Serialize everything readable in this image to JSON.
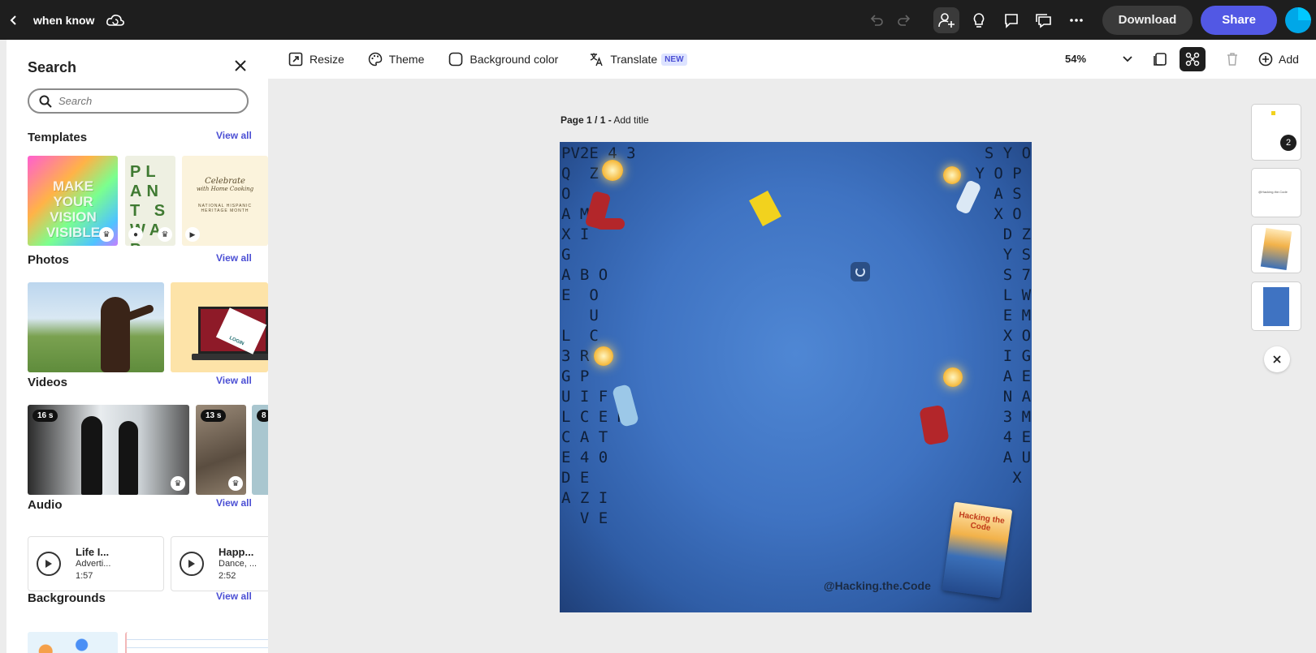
{
  "topbar": {
    "doc_title": "when know",
    "download_label": "Download",
    "share_label": "Share",
    "icons": [
      "back-icon",
      "cloud-sync-icon",
      "undo-icon",
      "redo-icon",
      "invite-user-icon",
      "lightbulb-icon",
      "comment-icon",
      "present-icon",
      "more-icon"
    ]
  },
  "panel": {
    "title": "Search",
    "search_placeholder": "Search",
    "view_all": "View all",
    "sections": {
      "templates": "Templates",
      "photos": "Photos",
      "videos": "Videos",
      "audio": "Audio",
      "backgrounds": "Backgrounds"
    },
    "templates": [
      {
        "text": "MAKE YOUR VISION VISIBLE"
      },
      {
        "text": "PLANT SWAP"
      },
      {
        "line1": "Celebrate",
        "line2": "with Home Cooking",
        "line3": "NATIONAL HISPANIC",
        "line4": "HERITAGE MONTH"
      }
    ],
    "photo_card_text": "LOGIN",
    "videos": [
      {
        "duration": "16 s"
      },
      {
        "duration": "13 s"
      },
      {
        "duration": "8"
      }
    ],
    "audio": [
      {
        "title": "Life I...",
        "sub": "Adverti...",
        "time": "1:57"
      },
      {
        "title": "Happ...",
        "sub": "Dance, ...",
        "time": "2:52"
      }
    ]
  },
  "toolbar": {
    "resize": "Resize",
    "theme": "Theme",
    "background_color": "Background color",
    "translate": "Translate",
    "new_badge": "NEW",
    "zoom": "54%",
    "add": "Add"
  },
  "canvas": {
    "page_label_bold": "Page 1 / 1 -",
    "page_label_action": " Add title",
    "handle": "@Hacking.the.Code",
    "book_title": "Hacking the Code"
  },
  "pages": {
    "count_badge": "2",
    "thumb_text": "@Hacking.the.Code"
  },
  "colors": {
    "accent": "#5258e4",
    "topbar": "#1e1e1e",
    "canvas_blue": "#3f73c2"
  }
}
